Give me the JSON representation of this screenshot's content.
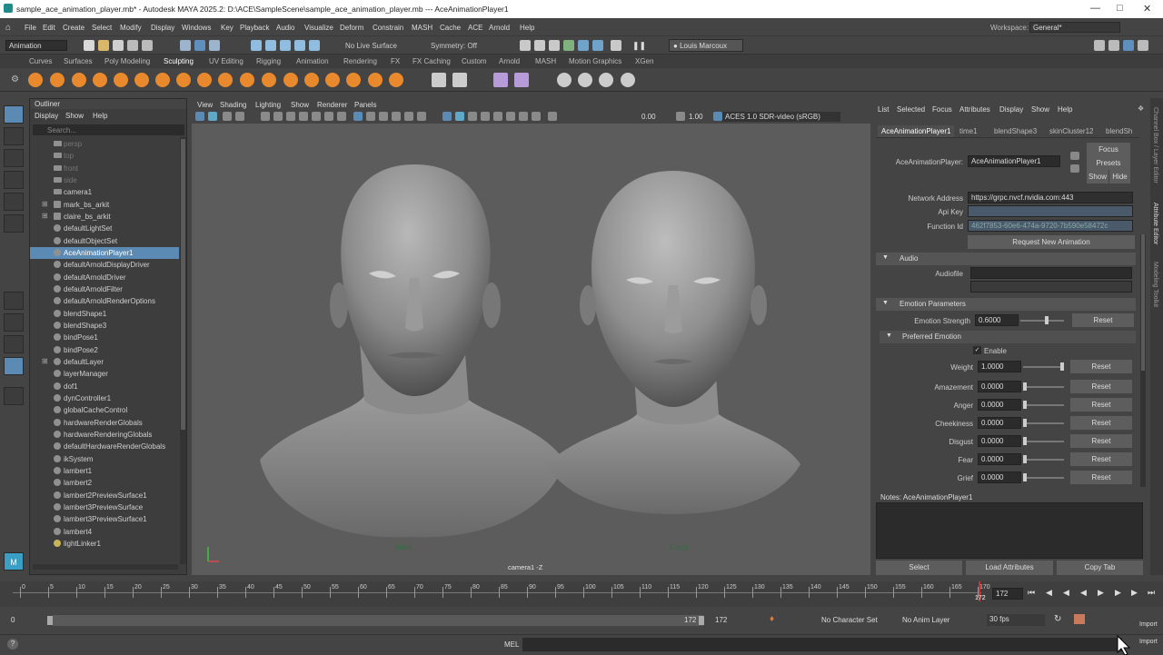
{
  "title": {
    "text": "sample_ace_animation_player.mb* - Autodesk MAYA 2025.2: D:\\ACE\\SampleScene\\sample_ace_animation_player.mb   ---   AceAnimationPlayer1"
  },
  "menus": [
    "File",
    "Edit",
    "Create",
    "Select",
    "Modify",
    "Display",
    "Windows",
    "Key",
    "Playback",
    "Audio",
    "Visualize",
    "Deform",
    "Constrain",
    "MASH",
    "Cache",
    "ACE",
    "Arnold",
    "Help"
  ],
  "workspace": {
    "label": "Workspace:",
    "value": "General*"
  },
  "status": {
    "mode": "Animation",
    "live": "No Live Surface",
    "symmetry": "Symmetry: Off",
    "user": "Louis Marcoux"
  },
  "shelf_tabs": [
    "Curves",
    "Surfaces",
    "Poly Modeling",
    "Sculpting",
    "UV Editing",
    "Rigging",
    "Animation",
    "Rendering",
    "FX",
    "FX Caching",
    "Custom",
    "Arnold",
    "MASH",
    "Motion Graphics",
    "XGen"
  ],
  "outliner": {
    "title": "Outliner",
    "menus": [
      "Display",
      "Show",
      "Help"
    ],
    "search": "Search...",
    "items": [
      "persp",
      "top",
      "front",
      "side",
      "camera1",
      "mark_bs_arkit",
      "claire_bs_arkit",
      "defaultLightSet",
      "defaultObjectSet",
      "AceAnimationPlayer1",
      "defaultArnoldDisplayDriver",
      "defaultArnoldDriver",
      "defaultArnoldFilter",
      "defaultArnoldRenderOptions",
      "blendShape1",
      "blendShape3",
      "bindPose1",
      "bindPose2",
      "defaultLayer",
      "layerManager",
      "dof1",
      "dynController1",
      "globalCacheControl",
      "hardwareRenderGlobals",
      "hardwareRenderingGlobals",
      "defaultHardwareRenderGlobals",
      "ikSystem",
      "lambert1",
      "lambert2",
      "lambert2PreviewSurface1",
      "lambert3PreviewSurface",
      "lambert3PreviewSurface1",
      "lambert4",
      "lightLinker1"
    ]
  },
  "viewport": {
    "menus": [
      "View",
      "Shading",
      "Lighting",
      "Show",
      "Renderer",
      "Panels"
    ],
    "v1": "0.00",
    "v2": "1.00",
    "colorspace": "ACES 1.0 SDR-video (sRGB)",
    "camera": "camera1 -Z",
    "label_left": "Mark",
    "label_right": "Claire"
  },
  "attr": {
    "menus": [
      "List",
      "Selected",
      "Focus",
      "Attributes",
      "Display",
      "Show",
      "Help"
    ],
    "tabs": [
      "AceAnimationPlayer1",
      "time1",
      "blendShape3",
      "skinCluster12",
      "blendSh"
    ],
    "node_label": "AceAnimationPlayer:",
    "node_value": "AceAnimationPlayer1",
    "focus": "Focus",
    "presets": "Presets",
    "show": "Show",
    "hide": "Hide",
    "network_label": "Network Address",
    "network_value": "https://grpc.nvcf.nvidia.com:443",
    "apikey_label": "Api Key",
    "function_label": "Function Id",
    "function_value": "462f7853-60e6-474a-9720-7b590e58472c",
    "request_btn": "Request New Animation",
    "audio_section": "Audio",
    "audiofile_label": "Audiofile",
    "emotion_section": "Emotion Parameters",
    "strength_label": "Emotion Strength",
    "strength_value": "0.6000",
    "pref_section": "Preferred Emotion",
    "enable_label": "Enable",
    "weight_label": "Weight",
    "weight_value": "1.0000",
    "emotions": [
      {
        "name": "Amazement",
        "value": "0.0000"
      },
      {
        "name": "Anger",
        "value": "0.0000"
      },
      {
        "name": "Cheekiness",
        "value": "0.0000"
      },
      {
        "name": "Disgust",
        "value": "0.0000"
      },
      {
        "name": "Fear",
        "value": "0.0000"
      },
      {
        "name": "Grief",
        "value": "0.0000"
      }
    ],
    "reset": "Reset",
    "notes": "Notes:  AceAnimationPlayer1",
    "bottom": [
      "Select",
      "Load Attributes",
      "Copy Tab"
    ]
  },
  "side_tabs": [
    "Channel Box / Layer Editor",
    "Attribute Editor",
    "Modeling Toolkit"
  ],
  "timeline": {
    "ticks": [
      "0",
      "5",
      "10",
      "15",
      "20",
      "25",
      "30",
      "35",
      "40",
      "45",
      "50",
      "55",
      "60",
      "65",
      "70",
      "75",
      "80",
      "85",
      "90",
      "95",
      "100",
      "105",
      "110",
      "115",
      "120",
      "125",
      "130",
      "135",
      "140",
      "145",
      "150",
      "155",
      "160",
      "165",
      "170"
    ],
    "current": "172",
    "field": "172"
  },
  "range": {
    "start": "0",
    "start2": "0",
    "end": "172",
    "end2": "172",
    "character": "No Character Set",
    "anim_layer": "No Anim Layer",
    "fps": "30 fps",
    "import1": "Import",
    "import2": "Import"
  },
  "cmd": {
    "lang": "MEL"
  }
}
